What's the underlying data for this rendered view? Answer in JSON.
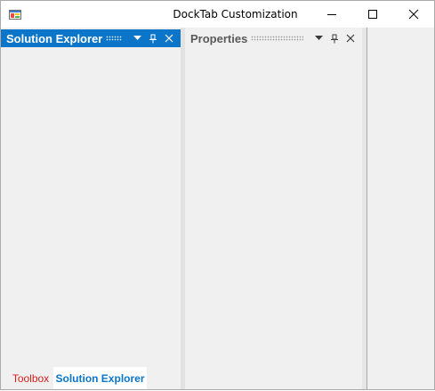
{
  "window": {
    "title": "DockTab Customization",
    "icons": {
      "app": "app-icon",
      "minimize": "minimize-icon",
      "maximize": "maximize-icon",
      "close": "close-icon"
    }
  },
  "panels": {
    "solution_explorer": {
      "title": "Solution Explorer",
      "state": "active",
      "icons": [
        "dropdown-arrow-icon",
        "pin-icon",
        "close-icon"
      ]
    },
    "properties": {
      "title": "Properties",
      "state": "inactive",
      "icons": [
        "dropdown-arrow-icon",
        "pin-icon",
        "close-icon"
      ]
    }
  },
  "bottom_tabs": [
    {
      "label": "Toolbox",
      "selected": false
    },
    {
      "label": "Solution Explorer",
      "selected": true
    }
  ],
  "colors": {
    "active_header": "#0a75c9",
    "toolbox_tab_text": "#d62020",
    "selected_tab_text": "#0a75c9",
    "panel_bg": "#f0f0f0"
  }
}
